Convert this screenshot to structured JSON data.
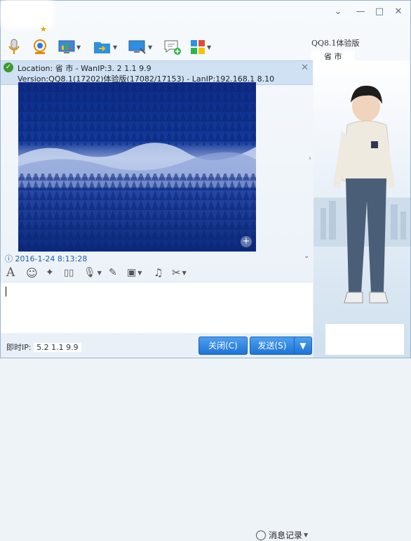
{
  "window": {
    "minimize_icon": "chevron-down-icon",
    "controls": [
      "—",
      "□",
      "✕"
    ]
  },
  "toolbar": {
    "items": [
      "voice-call-icon",
      "video-call-icon",
      "remote-assist-icon",
      "send-file-icon",
      "screen-share-icon",
      "add-participant-icon",
      "apps-icon"
    ]
  },
  "profile": {
    "version": "QQ8.1体验版",
    "location": "省 市"
  },
  "info": {
    "line1": "Location:  省  市  - WanIP:3. 2  1.1  9.9",
    "line2": "Version:QQ8.1(17202)体验版(17082/17153) - LanIP:192.168.1  8.10"
  },
  "chat": {
    "timestamp": "2016-1-24  8:13:28",
    "history_label": "消息记录"
  },
  "footer": {
    "ip_label": "即时IP:",
    "ip_value": "5.2  1.1  9.9",
    "close_label": "关闭(C)",
    "send_label": "发送(S)"
  },
  "colors": {
    "accent": "#1e74d6",
    "infobar": "#cfe1f3",
    "timestamp": "#1b5fb0"
  }
}
